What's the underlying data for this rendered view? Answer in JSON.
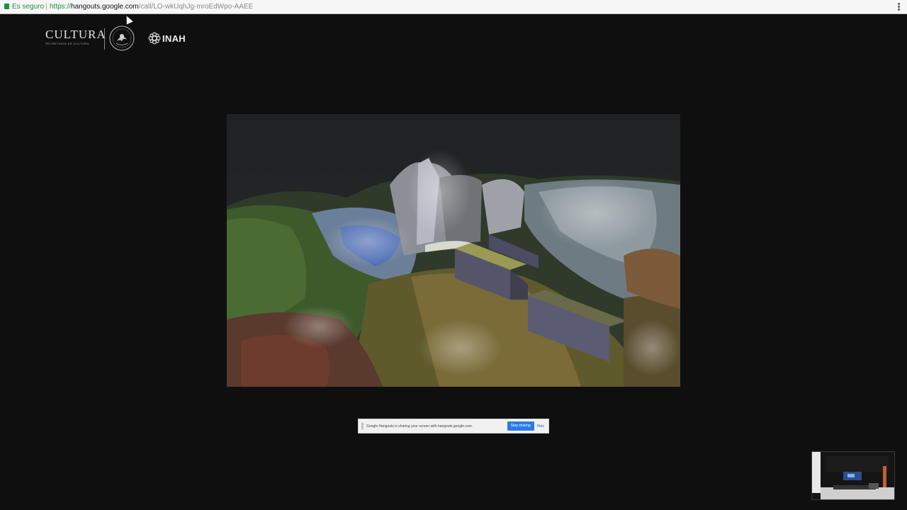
{
  "browser": {
    "security_label": "Es seguro",
    "separator": "|",
    "url_scheme": "https://",
    "url_host": "hangouts.google.com",
    "url_path": "/call/LO-wkUqhJg-mroEdWpo-AAEE",
    "menu_icon": "three-dot-menu-icon"
  },
  "branding": {
    "cultura_word": "CULTURA",
    "cultura_sub": "SECRETARÍA DE CULTURA",
    "inah_word": "INAH"
  },
  "screen_share": {
    "message": "Google Hangouts is sharing your screen with hangouts.google.com.",
    "stop_label": "Stop sharing",
    "hide_label": "Hide"
  },
  "colors": {
    "background": "#0f0f0f",
    "secure_green": "#1e8e3e",
    "stop_button_blue": "#2b7be4"
  }
}
